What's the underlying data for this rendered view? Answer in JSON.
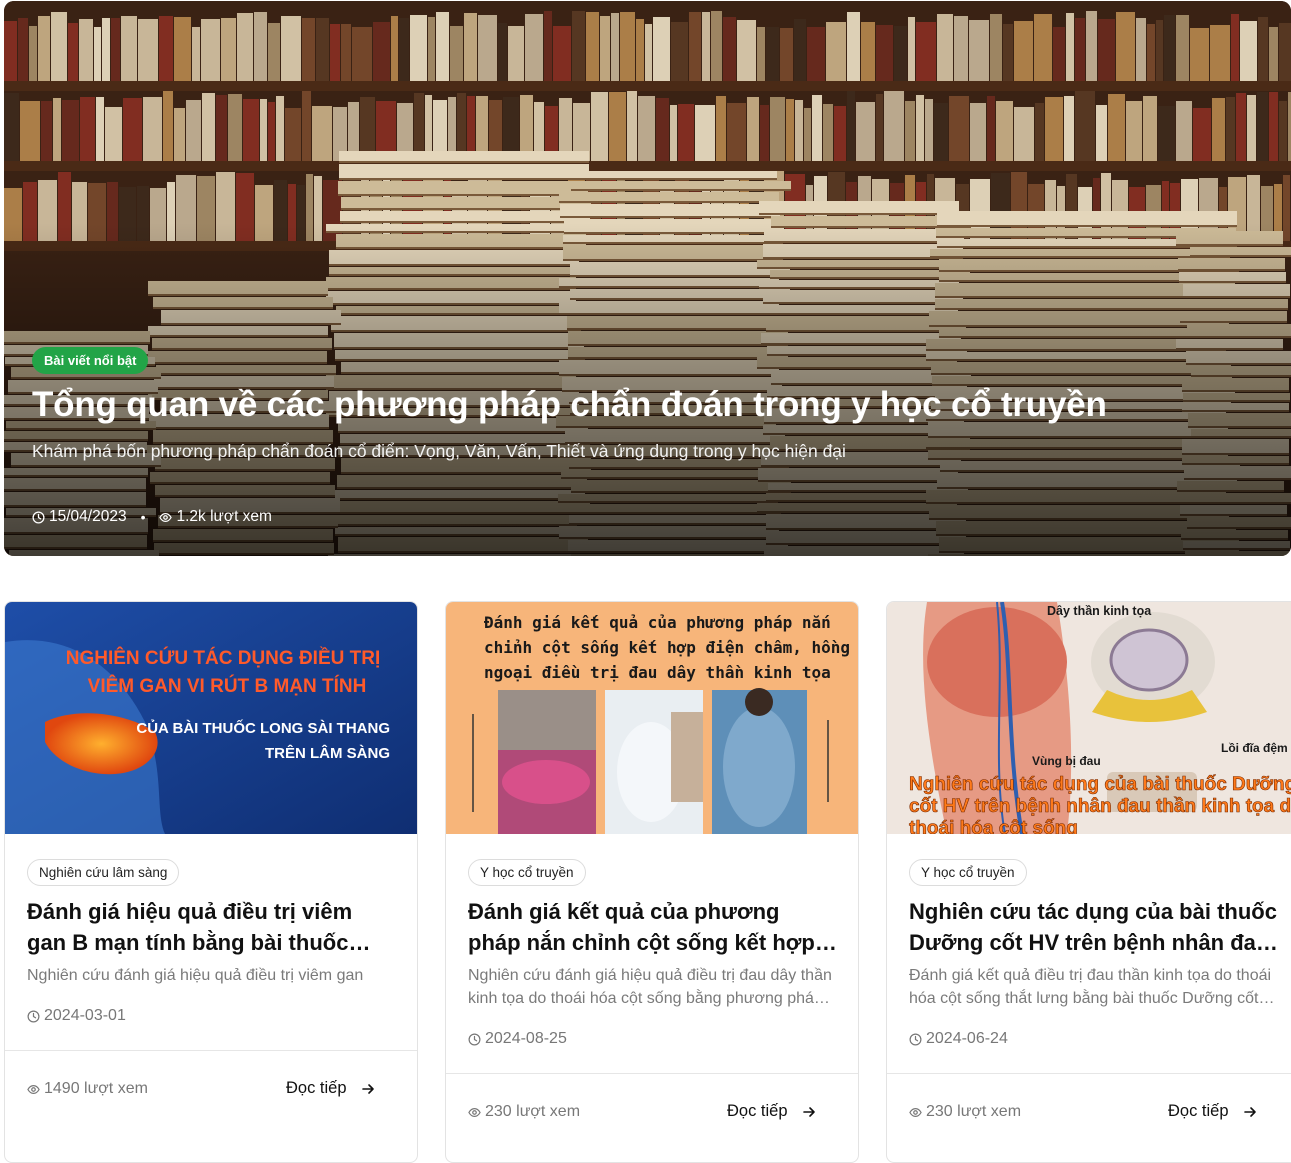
{
  "hero": {
    "badge": "Bài viết nổi bật",
    "title": "Tổng quan về các phương pháp chẩn đoán trong y học cổ truyền",
    "description": "Khám phá bốn phương pháp chẩn đoán cổ điển: Vọng, Văn, Vấn, Thiết và ứng dụng trong y học hiện đại",
    "date": "15/04/2023",
    "separator": "•",
    "views": "1.2k lượt xem",
    "icons": [
      "clock-icon",
      "eye-icon"
    ]
  },
  "cards": [
    {
      "image_text": [
        "NGHIÊN CỨU TÁC DỤNG ĐIỀU TRỊ",
        "VIÊM GAN VI RÚT B MẠN TÍNH",
        "CỦA BÀI THUỐC LONG SÀI THANG",
        "TRÊN LÂM SÀNG"
      ],
      "category": "Nghiên cứu lâm sàng",
      "title": "Đánh giá hiệu quả điều trị viêm gan B mạn tính bằng bài thuốc Long Sài Thang",
      "excerpt": "Nghiên cứu đánh giá hiệu quả điều trị viêm gan",
      "date": "2024-03-01",
      "views": "1490 lượt xem",
      "read_more": "Đọc tiếp"
    },
    {
      "image_text": [
        "Đánh giá kết quả của phương pháp nắn",
        "chỉnh cột sống kết hợp điện châm, hồng",
        "ngoại điều trị đau dây thần kinh tọa"
      ],
      "category": "Y học cổ truyền",
      "title": "Đánh giá kết quả của phương pháp nắn chỉnh cột sống kết hợp điện châm, hồng ngoại",
      "excerpt": "Nghiên cứu đánh giá hiệu quả điều trị đau dây thần kinh tọa do thoái hóa cột sống bằng phương pháp nắn chỉnh",
      "date": "2024-08-25",
      "views": "230 lượt xem",
      "read_more": "Đọc tiếp"
    },
    {
      "image_text": [
        "Dây thần kinh tọa",
        "Lồi đĩa đệm",
        "Vùng bị đau",
        "Nghiên cứu tác dụng của bài thuốc Dưỡng",
        "cốt HV trên bệnh nhân đau thần kinh tọa do",
        "thoái hóa cột sống"
      ],
      "category": "Y học cổ truyền",
      "title": "Nghiên cứu tác dụng của bài thuốc Dưỡng cốt HV trên bệnh nhân đau thần kinh tọa",
      "excerpt": "Đánh giá kết quả điều trị đau thần kinh tọa do thoái hóa cột sống thắt lưng bằng bài thuốc Dưỡng cốt HV",
      "date": "2024-06-24",
      "views": "230 lượt xem",
      "read_more": "Đọc tiếp"
    }
  ],
  "colors": {
    "badge_green": "#22a447",
    "text_dark": "#111111",
    "text_muted": "#777777",
    "border": "#e3e3e3"
  }
}
